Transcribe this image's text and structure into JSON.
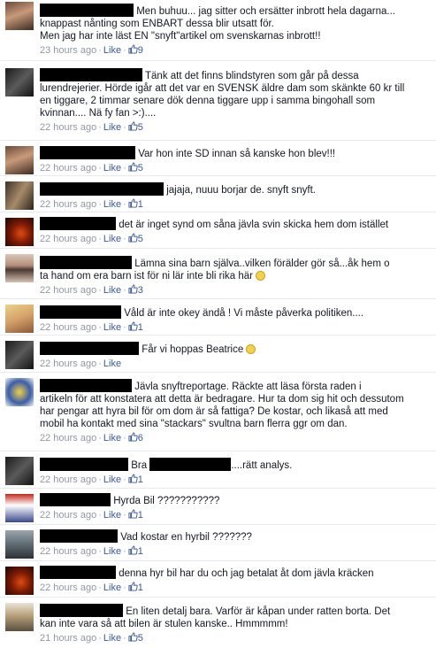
{
  "comments": [
    {
      "avatar_icon": "woman-portrait-avatar",
      "lines": [
        "Men buhuu... jag sitter och ersätter inbrott hela dagarna...",
        "knappast nånting som ENBART dessa blir utsatt för.",
        "Men jag har inte läst EN \"snyft\"artikel om svenskarnas inbrott!!"
      ],
      "time": "23 hours ago",
      "like_label": "Like",
      "likes": "9"
    },
    {
      "avatar_icon": "motorcycle-avatar",
      "lines": [
        "Tänk att det finns blindstyren som går på dessa",
        "lurendrejerier. Hörde igår att det var en SVENSK äldre dam som skänkte 60 kr till",
        "en tiggare, 2 timmar senare dök denna tiggare upp i samma bingohall som",
        "kvinnan.... Nä fy fan >:)...."
      ],
      "time": "22 hours ago",
      "like_label": "Like",
      "likes": "5"
    },
    {
      "avatar_icon": "woman-portrait-avatar",
      "lines": [
        "Var hon inte SD innan så kanske hon blev!!!"
      ],
      "time": "22 hours ago",
      "like_label": "Like",
      "likes": "5"
    },
    {
      "avatar_icon": "two-faces-avatar",
      "lines": [
        "jajaja, nuuu borjar de. snyft snyft."
      ],
      "time": "22 hours ago",
      "like_label": "Like",
      "likes": "1"
    },
    {
      "avatar_icon": "red-glow-avatar",
      "lines": [
        "det är inget synd om såna jävla svin skicka hem dom istället"
      ],
      "time": "22 hours ago",
      "like_label": "Like",
      "likes": "5"
    },
    {
      "avatar_icon": "eye-closeup-avatar",
      "lines": [
        "Lämna sina barn själva..vilken förälder gör så...åk hem o",
        "ta hand om era barn ist för ni lär inte bli rika här"
      ],
      "time": "22 hours ago",
      "like_label": "Like",
      "likes": "3"
    },
    {
      "avatar_icon": "blonde-woman-avatar",
      "lines": [
        "Våld är inte okey ändå ! Vi måste påverka politiken...."
      ],
      "time": "22 hours ago",
      "like_label": "Like",
      "likes": "1"
    },
    {
      "avatar_icon": "motorcycle-avatar",
      "lines": [
        "Får vi hoppas Beatrice"
      ],
      "time": "22 hours ago",
      "like_label": "Like",
      "likes": ""
    },
    {
      "avatar_icon": "crest-flags-avatar",
      "lines": [
        "Jävla snyftreportage. Räckte att läsa första raden i",
        "artikeln för att konstatera att detta är bedragare. Hur ta dom sig hit och dessutom",
        "har pengar att hyra bil för om dom är så fattiga? De kostar, och likaså att med",
        "mobil ha kontakt med sina \"stackars\" svultna barn flerra ggr om dan."
      ],
      "time": "22 hours ago",
      "like_label": "Like",
      "likes": "6"
    },
    {
      "avatar_icon": "motorcycle-avatar",
      "lines": [
        "Bra",
        "....rätt analys."
      ],
      "time": "22 hours ago",
      "like_label": "Like",
      "likes": "1"
    },
    {
      "avatar_icon": "flag-avatar",
      "lines": [
        "Hyrda Bil ???????????"
      ],
      "time": "22 hours ago",
      "like_label": "Like",
      "likes": "1"
    },
    {
      "avatar_icon": "car-avatar",
      "lines": [
        "Vad kostar en hyrbil ???????"
      ],
      "time": "22 hours ago",
      "like_label": "Like",
      "likes": "1"
    },
    {
      "avatar_icon": "red-glow-avatar",
      "lines": [
        "denna hyr bil har du och jag betalat åt dom jävla kräcken"
      ],
      "time": "22 hours ago",
      "like_label": "Like",
      "likes": "1"
    },
    {
      "avatar_icon": "man-portrait-avatar",
      "lines": [
        "En liten detalj bara. Varför är kåpan under ratten borta. Det",
        "kan inte vara så att bilen är stulen kanske.. Hmmmmm!"
      ],
      "time": "21 hours ago",
      "like_label": "Like",
      "likes": "5"
    }
  ],
  "colors": {
    "link": "#3b5998",
    "meta": "#9197a3",
    "text": "#141823",
    "redaction": "#000000"
  }
}
